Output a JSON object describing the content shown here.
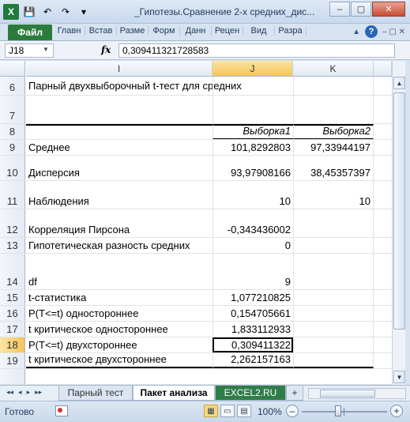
{
  "window": {
    "title": "_Гипотезы.Сравнение 2-х средних_дис...",
    "app_icon": "X",
    "minimize": "–",
    "restore": "▢",
    "close": "✕"
  },
  "quick_access": {
    "save": "💾",
    "undo": "↶",
    "redo": "↷",
    "customize": "▾"
  },
  "ribbon": {
    "file_tab": "Файл",
    "tabs": [
      "Главн",
      "Встав",
      "Разме",
      "Форм",
      "Данн",
      "Рецен",
      "Вид",
      "Разра"
    ],
    "help": "?",
    "minimize_ribbon": "▲",
    "window_controls": "– ▢ ✕"
  },
  "formula_bar": {
    "name_box": "J18",
    "fx": "fx",
    "value": "0,309411321728583"
  },
  "columns": [
    "I",
    "J",
    "K"
  ],
  "active_column": "J",
  "rows": [
    {
      "num": "6",
      "i": "Парный двухвыборочный t-тест для средних",
      "j": "",
      "k": ""
    },
    {
      "num": "7",
      "i": "",
      "j": "",
      "k": ""
    },
    {
      "num": "8",
      "i": "",
      "j": "Выборка1",
      "k": "Выборка2"
    },
    {
      "num": "9",
      "i": "Среднее",
      "j": "101,8292803",
      "k": "97,33944197"
    },
    {
      "num": "10",
      "i": "Дисперсия",
      "j": "93,97908166",
      "k": "38,45357397"
    },
    {
      "num": "11",
      "i": "Наблюдения",
      "j": "10",
      "k": "10"
    },
    {
      "num": "12",
      "i": "Корреляция Пирсона",
      "j": "-0,343436002",
      "k": ""
    },
    {
      "num": "13",
      "i": "Гипотетическая разность средних",
      "j": "0",
      "k": ""
    },
    {
      "num": "14",
      "i": "df",
      "j": "9",
      "k": ""
    },
    {
      "num": "15",
      "i": "t-статистика",
      "j": "1,077210825",
      "k": ""
    },
    {
      "num": "16",
      "i": "P(T<=t) одностороннее",
      "j": "0,154705661",
      "k": ""
    },
    {
      "num": "17",
      "i": "t критическое одностороннее",
      "j": "1,833112933",
      "k": ""
    },
    {
      "num": "18",
      "i": "P(T<=t) двухстороннее",
      "j": "0,309411322",
      "k": ""
    },
    {
      "num": "19",
      "i": "t критическое двухстороннее",
      "j": "2,262157163",
      "k": ""
    }
  ],
  "active_row": "18",
  "sheets": {
    "nav": [
      "◂◂",
      "◂",
      "▸",
      "▸▸"
    ],
    "tabs": [
      "Парный тест",
      "Пакет анализа",
      "EXCEL2.RU"
    ],
    "active": "Пакет анализа",
    "insert_icon": "+"
  },
  "status": {
    "ready": "Готово",
    "zoom": "100%",
    "zoom_minus": "–",
    "zoom_plus": "+"
  }
}
